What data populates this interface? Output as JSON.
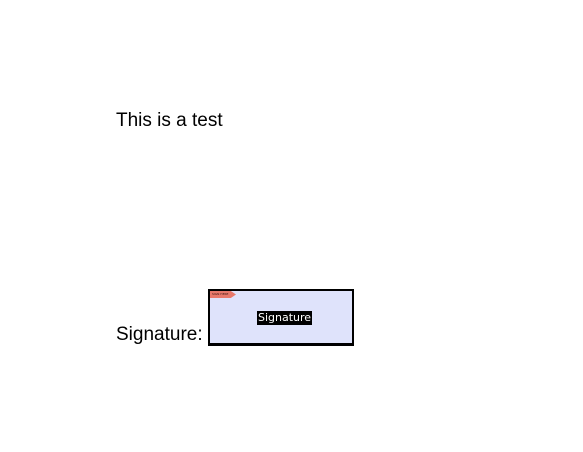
{
  "document": {
    "intro_text": "This is a test",
    "signature_label": "Signature:",
    "signature_field": {
      "tag_text": "SIGN HERE",
      "caption": "Signature",
      "fill_color": "#dfe3fb",
      "tag_color": "#e8786a"
    }
  }
}
